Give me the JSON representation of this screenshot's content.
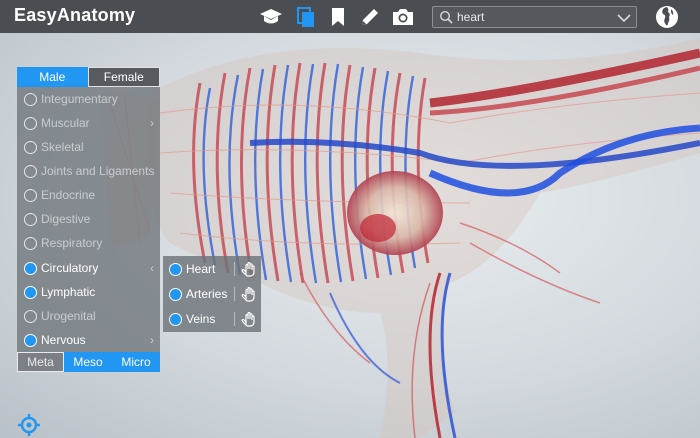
{
  "app": {
    "title": "EasyAnatomy"
  },
  "toolbar": {
    "icons": [
      "graduation-cap-icon",
      "copy-layers-icon",
      "bookmark-icon",
      "pencil-icon",
      "camera-icon",
      "globe-icon"
    ],
    "accent": "#2196f3"
  },
  "search": {
    "value": "heart",
    "placeholder": ""
  },
  "sex_toggle": {
    "male": "Male",
    "female": "Female",
    "selected": "Male"
  },
  "systems": [
    {
      "label": "Integumentary",
      "checked": false
    },
    {
      "label": "Muscular",
      "checked": false,
      "has_submenu": true
    },
    {
      "label": "Skeletal",
      "checked": false
    },
    {
      "label": "Joints and Ligaments",
      "checked": false
    },
    {
      "label": "Endocrine",
      "checked": false
    },
    {
      "label": "Digestive",
      "checked": false
    },
    {
      "label": "Respiratory",
      "checked": false
    },
    {
      "label": "Circulatory",
      "checked": true,
      "has_submenu": true,
      "expanded": true
    },
    {
      "label": "Lymphatic",
      "checked": true
    },
    {
      "label": "Urogenital",
      "checked": false
    },
    {
      "label": "Nervous",
      "checked": true,
      "has_submenu": true
    }
  ],
  "chevrons": {
    "right": "›",
    "left": "‹"
  },
  "level_toggle": {
    "meta": "Meta",
    "meso": "Meso",
    "micro": "Micro",
    "selected": [
      "Meso",
      "Micro"
    ]
  },
  "circulatory_submenu": [
    {
      "label": "Heart",
      "checked": true
    },
    {
      "label": "Arteries",
      "checked": true
    },
    {
      "label": "Veins",
      "checked": true
    }
  ]
}
